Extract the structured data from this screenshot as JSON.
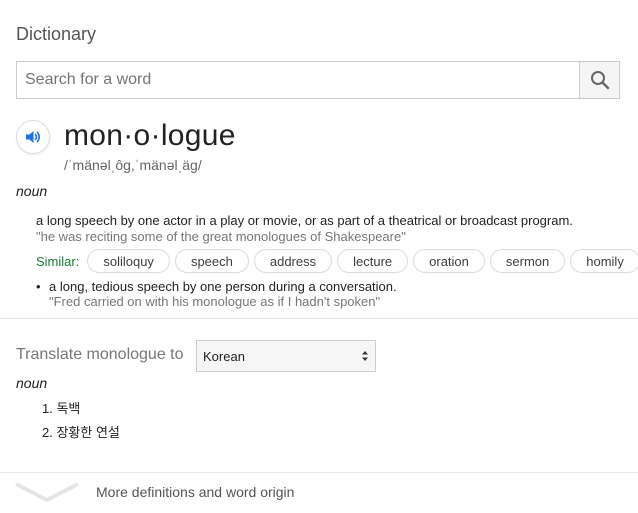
{
  "header": {
    "title": "Dictionary"
  },
  "search": {
    "placeholder": "Search for a word",
    "value": ""
  },
  "entry": {
    "word": "mon·o·logue",
    "phonetic": "/ˈmänəlˌôg,ˈmänəlˌäg/",
    "part_of_speech": "noun",
    "senses": [
      {
        "definition": "a long speech by one actor in a play or movie, or as part of a theatrical or broadcast program.",
        "example": "\"he was reciting some of the great monologues of Shakespeare\""
      },
      {
        "bullet": "•",
        "definition": "a long, tedious speech by one person during a conversation.",
        "example": "\"Fred carried on with his monologue as if I hadn't spoken\""
      }
    ],
    "similar_label": "Similar:",
    "similar": [
      "soliloquy",
      "speech",
      "address",
      "lecture",
      "oration",
      "sermon",
      "homily"
    ]
  },
  "translate": {
    "label": "Translate monologue to",
    "selected_language": "Korean",
    "part_of_speech": "noun",
    "items": [
      "1. 독백",
      "2. 장황한 연설"
    ]
  },
  "footer": {
    "more_label": "More definitions and word origin"
  },
  "colors": {
    "similar_label": "#1a7d32",
    "speaker": "#1a73e8"
  }
}
